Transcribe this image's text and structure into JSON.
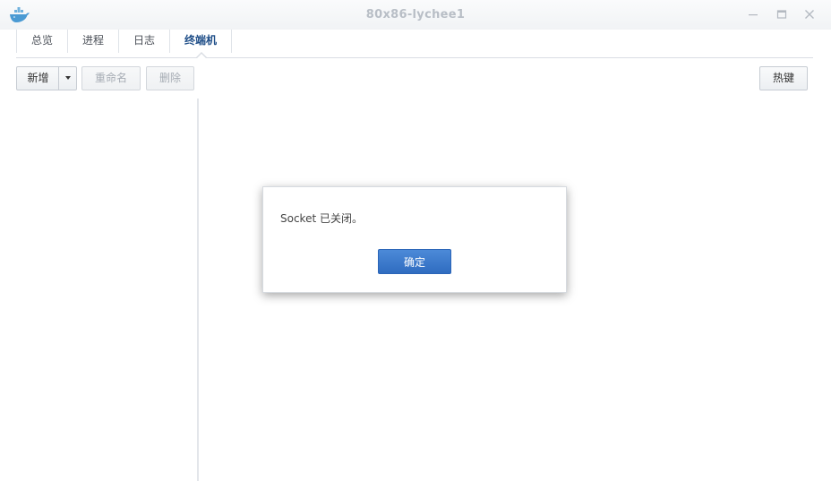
{
  "window": {
    "title": "80x86-lychee1",
    "app_icon": "docker-whale-icon"
  },
  "tabs": [
    {
      "label": "总览",
      "active": false
    },
    {
      "label": "进程",
      "active": false
    },
    {
      "label": "日志",
      "active": false
    },
    {
      "label": "终端机",
      "active": true
    }
  ],
  "toolbar": {
    "new_label": "新增",
    "rename_label": "重命名",
    "delete_label": "删除",
    "hotkey_label": "热键"
  },
  "dialog": {
    "message": "Socket 已关闭。",
    "ok_label": "确定"
  },
  "colors": {
    "accent": "#2f6cc0",
    "active_tab": "#1f4e88",
    "title_text": "#b8bec6"
  }
}
